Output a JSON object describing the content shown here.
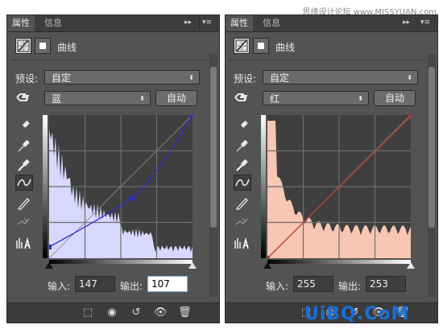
{
  "watermark": "思缘设计论坛 www.MISSYUAN.com",
  "logo_text": "UiBQ.CoM",
  "logo_subtext": "www.psahz.com",
  "panels": [
    {
      "tabs": [
        "属性",
        "信息"
      ],
      "title": "曲线",
      "preset_label": "预设:",
      "preset_value": "自定",
      "channel_value": "蓝",
      "auto_label": "自动",
      "input_label": "输入:",
      "input_value": "147",
      "output_label": "输出:",
      "output_value": "107",
      "curve_color": "#2a2fd0",
      "hist_color": "#d8d8ff",
      "points": [
        [
          0,
          20
        ],
        [
          147,
          107
        ],
        [
          255,
          255
        ]
      ]
    },
    {
      "tabs": [
        "属性",
        "信息"
      ],
      "title": "曲线",
      "preset_label": "预设:",
      "preset_value": "自定",
      "channel_value": "红",
      "auto_label": "自动",
      "input_label": "输入:",
      "input_value": "255",
      "output_label": "输出:",
      "output_value": "253",
      "curve_color": "#c0392b",
      "hist_color": "#f7c7b3",
      "points": [
        [
          0,
          0
        ],
        [
          255,
          253
        ]
      ]
    }
  ],
  "icons": [
    "curves-icon",
    "mask-icon",
    "hand-adjust-icon",
    "black-eyedropper-icon",
    "gray-eyedropper-icon",
    "white-eyedropper-icon",
    "curve-tool-icon",
    "pencil-icon",
    "smooth-icon",
    "clipping-icon",
    "clip-to-layer-icon",
    "view-previous-icon",
    "reset-icon",
    "visibility-icon",
    "delete-icon"
  ]
}
